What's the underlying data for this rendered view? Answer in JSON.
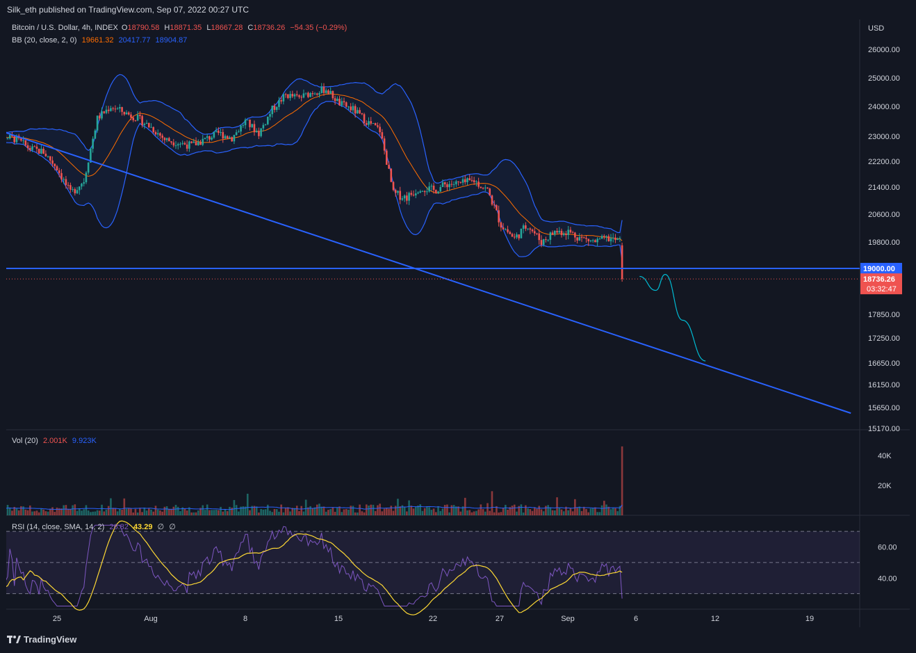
{
  "header": {
    "published": "Silk_eth published on TradingView.com, Sep 07, 2022 00:27 UTC"
  },
  "legend": {
    "symbol": "Bitcoin / U.S. Dollar, 4h, INDEX",
    "o_label": "O",
    "o": "18790.58",
    "h_label": "H",
    "h": "18871.35",
    "l_label": "L",
    "l": "18667.28",
    "c_label": "C",
    "c": "18736.26",
    "change": "−54.35 (−0.29%)",
    "bb_label": "BB (20, close, 2, 0)",
    "bb_basis": "19661.32",
    "bb_upper": "20417.77",
    "bb_lower": "18904.87",
    "vol_label": "Vol (20)",
    "vol_value": "2.001K",
    "vol_ma": "9.923K",
    "rsi_label": "RSI (14, close, SMA, 14, 2)",
    "rsi_value": "26.82",
    "rsi_ma": "43.29",
    "rsi_extra1": "∅",
    "rsi_extra2": "∅"
  },
  "axis": {
    "currency": "USD",
    "price_ticks": [
      "26000.00",
      "25000.00",
      "24000.00",
      "23000.00",
      "22200.00",
      "21400.00",
      "20600.00",
      "19800.00",
      "17850.00",
      "17250.00",
      "16650.00",
      "16150.00",
      "15650.00",
      "15170.00"
    ],
    "vol_ticks": [
      "40K",
      "20K"
    ],
    "rsi_ticks": [
      "60.00",
      "40.00"
    ],
    "x_ticks": [
      "25",
      "Aug",
      "8",
      "15",
      "22",
      "27",
      "Sep",
      "6",
      "12",
      "19"
    ]
  },
  "price_labels": {
    "level": "19000.00",
    "last": "18736.26",
    "countdown": "03:32:47"
  },
  "colors": {
    "background": "#131722",
    "up": "#26a69a",
    "down": "#ef5350",
    "bb_band": "#2962ff",
    "bb_basis": "#ff6d00",
    "trendline": "#2962ff",
    "projection": "#00bcd4",
    "rsi": "#7e57c2",
    "rsi_ma": "#fdd835"
  },
  "chart_data": {
    "type": "candlestick",
    "title": "Bitcoin / U.S. Dollar, 4h, INDEX",
    "ylim": [
      15170,
      26500
    ],
    "ohlc_last": {
      "open": 18790.58,
      "high": 18871.35,
      "low": 18667.28,
      "close": 18736.26
    },
    "close_path_approx": [
      [
        "Jul 21",
        23000
      ],
      [
        "Jul 22",
        22900
      ],
      [
        "Jul 23",
        22600
      ],
      [
        "Jul 24",
        22500
      ],
      [
        "Jul 25",
        22000
      ],
      [
        "Jul 26",
        21200
      ],
      [
        "Jul 27",
        21600
      ],
      [
        "Jul 28",
        23600
      ],
      [
        "Jul 29",
        24000
      ],
      [
        "Jul 30",
        23800
      ],
      [
        "Jul 31",
        23600
      ],
      [
        "Aug 1",
        23300
      ],
      [
        "Aug 2",
        22900
      ],
      [
        "Aug 3",
        22800
      ],
      [
        "Aug 4",
        22700
      ],
      [
        "Aug 5",
        22900
      ],
      [
        "Aug 6",
        23100
      ],
      [
        "Aug 7",
        22950
      ],
      [
        "Aug 8",
        23500
      ],
      [
        "Aug 9",
        23100
      ],
      [
        "Aug 10",
        23900
      ],
      [
        "Aug 11",
        24400
      ],
      [
        "Aug 12",
        24300
      ],
      [
        "Aug 13",
        24500
      ],
      [
        "Aug 14",
        24600
      ],
      [
        "Aug 15",
        24100
      ],
      [
        "Aug 16",
        23900
      ],
      [
        "Aug 17",
        23500
      ],
      [
        "Aug 18",
        23200
      ],
      [
        "Aug 19",
        21200
      ],
      [
        "Aug 20",
        21100
      ],
      [
        "Aug 21",
        21400
      ],
      [
        "Aug 22",
        21300
      ],
      [
        "Aug 23",
        21500
      ],
      [
        "Aug 24",
        21500
      ],
      [
        "Aug 25",
        21600
      ],
      [
        "Aug 26",
        21300
      ],
      [
        "Aug 27",
        20300
      ],
      [
        "Aug 28",
        19900
      ],
      [
        "Aug 29",
        20300
      ],
      [
        "Aug 30",
        19800
      ],
      [
        "Aug 31",
        20100
      ],
      [
        "Sep 1",
        20100
      ],
      [
        "Sep 2",
        19900
      ],
      [
        "Sep 3",
        19800
      ],
      [
        "Sep 4",
        19900
      ],
      [
        "Sep 5",
        19800
      ],
      [
        "Sep 6",
        18736.26
      ]
    ],
    "horizontal_level": 19000,
    "trendline": {
      "start": [
        "Jul 20",
        23300
      ],
      "end": [
        "Sep 22",
        15520
      ]
    },
    "projection_path": [
      [
        "Sep 6.3",
        18800
      ],
      [
        "Sep 7.5",
        18450
      ],
      [
        "Sep 8.2",
        18850
      ],
      [
        "Sep 9.5",
        17700
      ],
      [
        "Sep 11.2",
        16700
      ]
    ],
    "volume_last": "2.001K",
    "volume_ma": "9.923K",
    "rsi": {
      "last": 26.82,
      "ma": 43.29,
      "levels": [
        70,
        50,
        30
      ]
    }
  }
}
